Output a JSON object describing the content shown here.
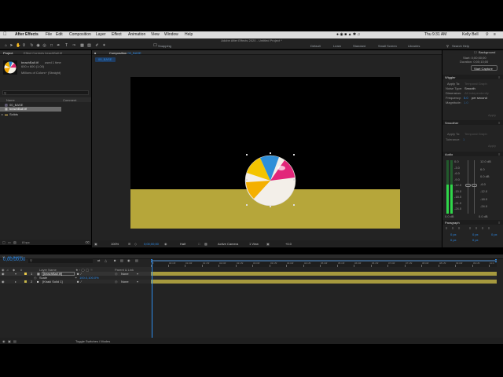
{
  "menubar": {
    "app_name": "After Effects",
    "items": [
      "File",
      "Edit",
      "Composition",
      "Layer",
      "Effect",
      "Animation",
      "View",
      "Window",
      "Help"
    ],
    "status": {
      "time": "Thu 9:31 AM",
      "user": "Kelly Bell"
    }
  },
  "window": {
    "title": "Adobe After Effects 2020 - Untitled Project *"
  },
  "toolbar": {
    "snapping_label": "Snapping",
    "workspaces": [
      "Default",
      "Learn",
      "Standard",
      "Small Screen",
      "Libraries"
    ],
    "search_placeholder": "Search Help"
  },
  "project_panel": {
    "tab_label": "Project",
    "effect_controls_label": "Effect Controls beachBall.tif",
    "preview": {
      "name": "beachBall.tif",
      "line2": "used 1 time",
      "line3": "600 x 600 (1.00)",
      "line4": "Millions of Colors+ (Straight)"
    },
    "columns": {
      "name": "Name",
      "comment": "Comment"
    },
    "items": [
      "00_BASE",
      "beachBall.tif",
      "Solids"
    ],
    "bpc_label": "8 bpc"
  },
  "composition": {
    "tab_label": "Composition",
    "comp_name": "00_BASE",
    "breadcrumb": "00_BASE",
    "footer": {
      "zoom": "100%",
      "timecode": "0;00;00;00",
      "resolution": "Half",
      "camera": "Active Camera",
      "views": "1 View",
      "exposure": "+0.0"
    }
  },
  "right_panel": {
    "background_label": "Background",
    "start_label": "Start: 0;00;00;00",
    "duration_label": "Duration: 0;00;10;00",
    "start_capture": "Start Capture",
    "wiggler": {
      "title": "Wiggler",
      "apply_to_label": "Apply To:",
      "apply_to_value": "Temporal Graph",
      "noise_type_label": "Noise Type:",
      "noise_type_value": "Smooth",
      "dimension_label": "Dimension:",
      "dimension_value": "All Independently",
      "frequency_label": "Frequency:",
      "frequency_value": "5.0",
      "frequency_unit": "per second",
      "magnitude_label": "Magnitude:",
      "magnitude_value": "1.0",
      "apply_button": "Apply"
    },
    "smoother": {
      "title": "Smoother",
      "apply_to_label": "Apply To:",
      "apply_to_value": "Temporal Graph",
      "tolerance_label": "Tolerance:",
      "tolerance_value": "1",
      "apply_button": "Apply"
    },
    "audio": {
      "title": "Audio",
      "scale_left": [
        "0.0",
        "-3.0",
        "-6.0",
        "-9.0",
        "-12.0",
        "-15.0",
        "-18.0",
        "-21.0",
        "-24.0"
      ],
      "scale_right": [
        "12.0 dB",
        "6.0",
        "0.0 dB",
        "-6.0",
        "-12.0",
        "-18.0",
        "-24.0"
      ],
      "level_db_left": "0.0 dB",
      "level_db_right": "0.0 dB",
      "meter_fill": 0.55
    },
    "paragraph": {
      "title": "Paragraph",
      "indent_values": [
        "0 px",
        "0 px",
        "0 px",
        "0 px",
        "0 px"
      ]
    }
  },
  "timeline": {
    "tab_label": "00_BASE",
    "timecode": "0;00;00;00",
    "search_placeholder": "",
    "columns": {
      "layer_name": "Layer Name",
      "parent": "Parent & Link"
    },
    "ruler_ticks": [
      "0f",
      "00:15f",
      "01:00f",
      "01:15f",
      "02:00f",
      "02:15f",
      "03:00f",
      "03:15f",
      "04:00f",
      "04:15f",
      "05:00f",
      "05:15f",
      "06:00f",
      "06:15f",
      "07:00f",
      "07:15f",
      "08:00f",
      "08:15f",
      "09:00f",
      "09:15f",
      "10:0"
    ],
    "layers": [
      {
        "num": "1",
        "name": "[beachBall.tif]",
        "parent": "None",
        "color": "#e8c94a"
      },
      {
        "num": "2",
        "name": "[Khaki Solid 1]",
        "parent": "None",
        "color": "#c8b84a"
      }
    ],
    "property": {
      "name": "Scale",
      "value": "100.0,100.0%"
    },
    "footer_label": "Toggle Switches / Modes"
  },
  "colors": {
    "accent": "#2d8ceb",
    "ground": "#b6a63a",
    "track_bar": "#a6993e",
    "meter": "#2fd74a"
  }
}
